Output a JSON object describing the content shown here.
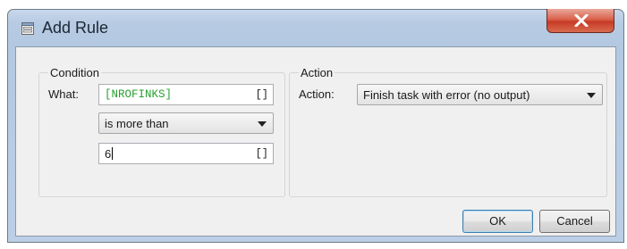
{
  "window": {
    "title": "Add Rule",
    "title_icon": "form-icon",
    "close_icon": "close-icon"
  },
  "condition": {
    "group_title": "Condition",
    "what_label": "What:",
    "what_value": "[NROFINKS]",
    "what_button": "[]",
    "operator_selected": "is more than",
    "compare_value": "6",
    "compare_button": "[]"
  },
  "action": {
    "group_title": "Action",
    "action_label": "Action:",
    "action_selected": "Finish task with error (no output)"
  },
  "buttons": {
    "ok": "OK",
    "cancel": "Cancel"
  },
  "colors": {
    "variable_text": "#27a02f",
    "titlebar": "#b7cbe3",
    "close_button": "#c73a26"
  }
}
